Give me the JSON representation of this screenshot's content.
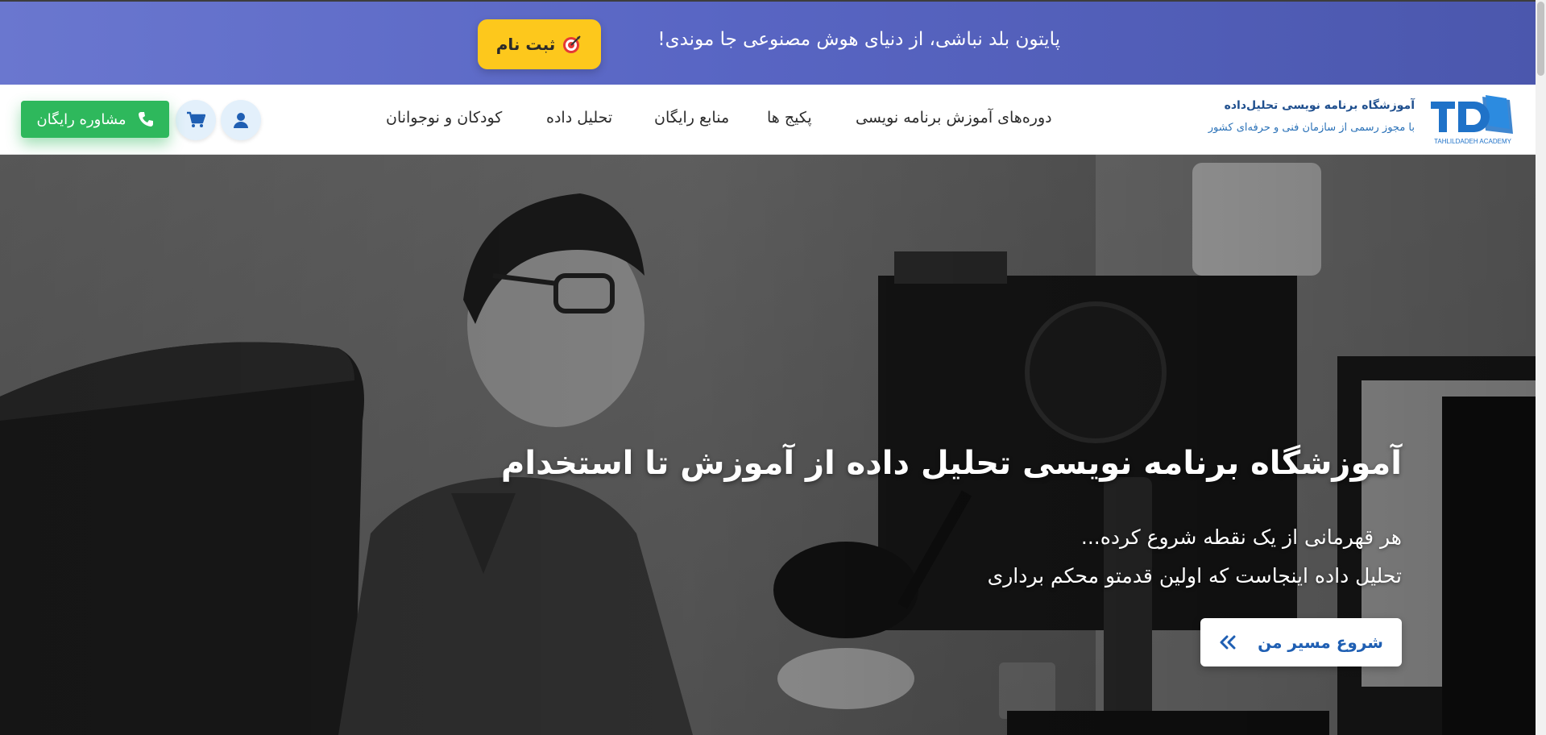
{
  "promo": {
    "text": "پایتون بلد نباشی، از دنیای هوش مصنوعی جا موندی!",
    "button_label": "ثبت نام",
    "button_icon": "target-icon",
    "background": "#5966c4",
    "button_color": "#fdc81c"
  },
  "header": {
    "logo_caption": "TAHLILDADEH ACADEMY",
    "brand_title": "آموزشگاه برنامه نویسی تحلیل‌داده",
    "brand_subtitle": "با مجوز رسمی از سازمان فنی و حرفه‌ای کشور",
    "nav": [
      "دوره‌های آموزش برنامه نویسی",
      "پکیج ها",
      "منابع رایگان",
      "تحلیل داده",
      "کودکان و نوجوانان"
    ],
    "user_icon": "user-icon",
    "cart_icon": "cart-icon",
    "consult_label": "مشاوره رایگان",
    "consult_icon": "phone-icon",
    "accent_green": "#2eb85c",
    "brand_blue": "#1f72c8"
  },
  "hero": {
    "title": "آموزشگاه برنامه نویسی تحلیل داده از آموزش تا استخدام",
    "line1": "هر قهرمانی از یک نقطه شروع کرده...",
    "line2": "تحلیل داده اینجاست که اولین قدمتو محکم برداری",
    "cta_label": "شروع مسیر من",
    "cta_icon": "double-chevron-left-icon"
  }
}
